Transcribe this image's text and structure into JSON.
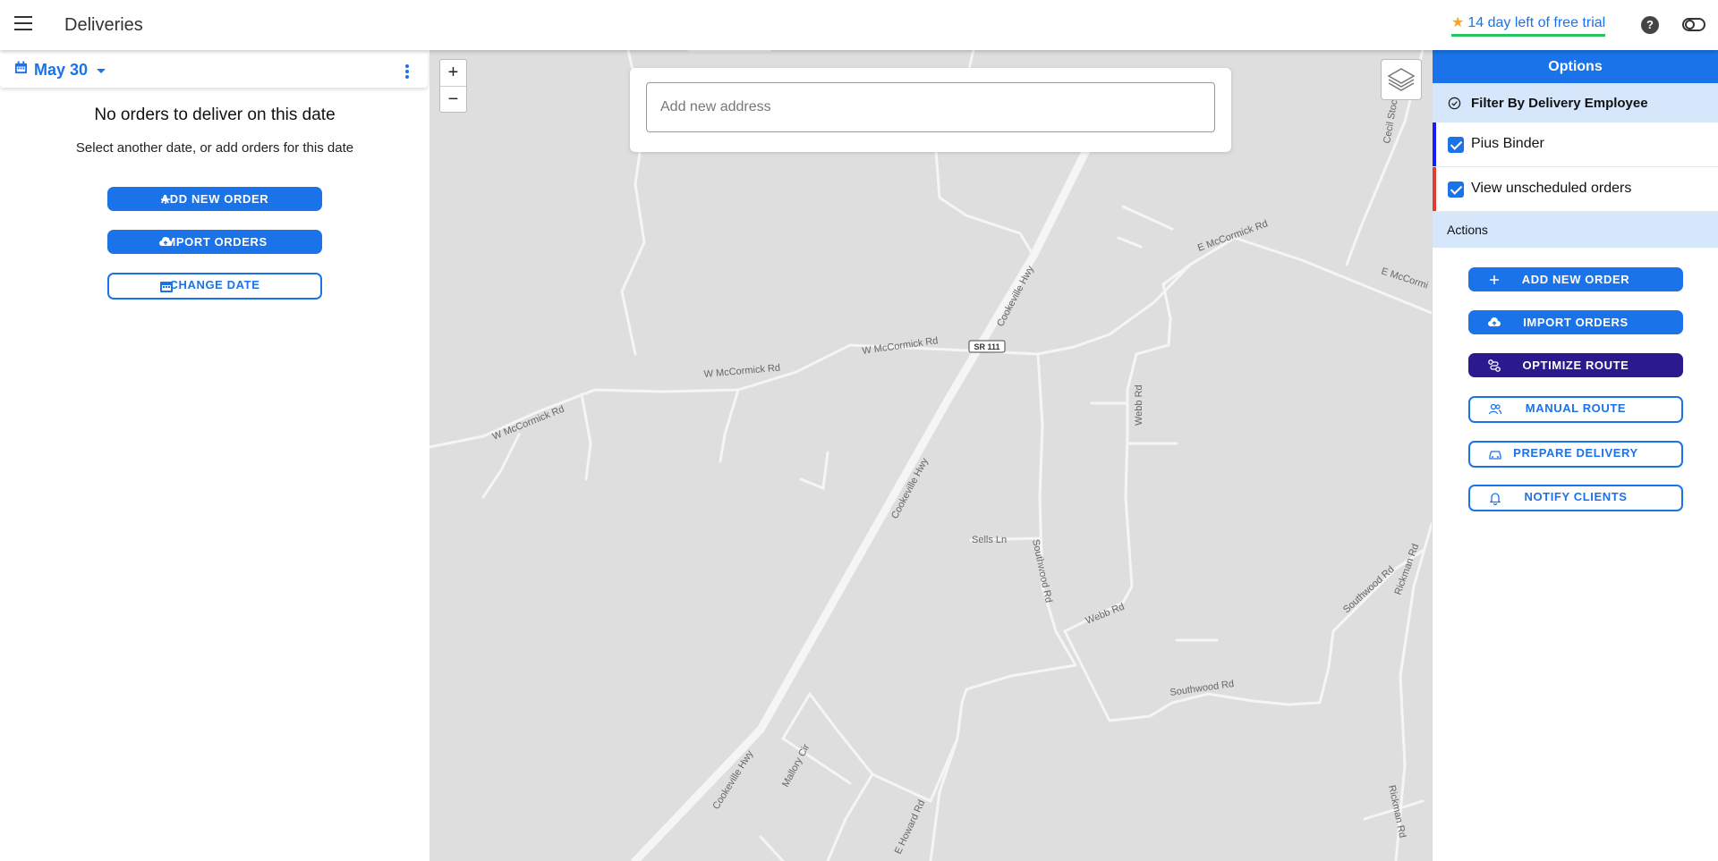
{
  "header": {
    "menu_icon": "hamburger-icon",
    "title": "Deliveries",
    "trial_text": "14 day left of free trial",
    "trial_icon": "star-icon",
    "help_icon": "help-icon",
    "toggle_icon": "toggle-icon"
  },
  "left_panel": {
    "date_label": "May 30",
    "empty_title": "No orders to deliver on this date",
    "empty_subtitle": "Select another date, or add orders for this date",
    "buttons": {
      "add_new_order": "ADD NEW ORDER",
      "import_orders": "IMPORT ORDERS",
      "change_date": "CHANGE DATE"
    }
  },
  "map": {
    "zoom_in": "+",
    "zoom_out": "−",
    "address_placeholder": "Add new address",
    "road_labels": {
      "cookeville_hwy_1": "Cookeville Hwy",
      "cookeville_hwy_2": "Cookeville Hwy",
      "cookeville_hwy_3": "Cookeville Hwy",
      "w_mccormick_1": "W McCormick Rd",
      "w_mccormick_2": "W McCormick Rd",
      "w_mccormick_3": "W McCormick Rd",
      "e_mccormick_1": "E McCormick Rd",
      "e_mccormick_2": "E McCormi",
      "sr111": "SR 111",
      "webb_1": "Webb Rd",
      "webb_2": "Webb Rd",
      "sells": "Sells Ln",
      "southwood_1": "Southwood Rd",
      "southwood_2": "Southwood Rd",
      "southwood_3": "Southwood Rd",
      "rickman_1": "Rickman Rd",
      "rickman_2": "Rickman Rd",
      "mallory": "Mallory Cir",
      "e_howard": "E Howard Rd",
      "cecil": "Cecil Stoc"
    }
  },
  "right_panel": {
    "options_title": "Options",
    "filter_title": "Filter By Delivery Employee",
    "employees": [
      {
        "label": "Pius Binder",
        "color": "#1a1aff"
      },
      {
        "label": "View unscheduled orders",
        "color": "#e53935"
      }
    ],
    "actions_title": "Actions",
    "buttons": {
      "add_new_order": "ADD NEW ORDER",
      "import_orders": "IMPORT ORDERS",
      "optimize_route": "OPTIMIZE ROUTE",
      "manual_route": "MANUAL ROUTE",
      "prepare_delivery": "PREPARE DELIVERY",
      "notify_clients": "NOTIFY CLIENTS"
    }
  },
  "colors": {
    "primary": "#1a73e8",
    "optimize": "#2a1a8e",
    "trial_underline": "#22c55e",
    "map_bg": "#dedede"
  }
}
